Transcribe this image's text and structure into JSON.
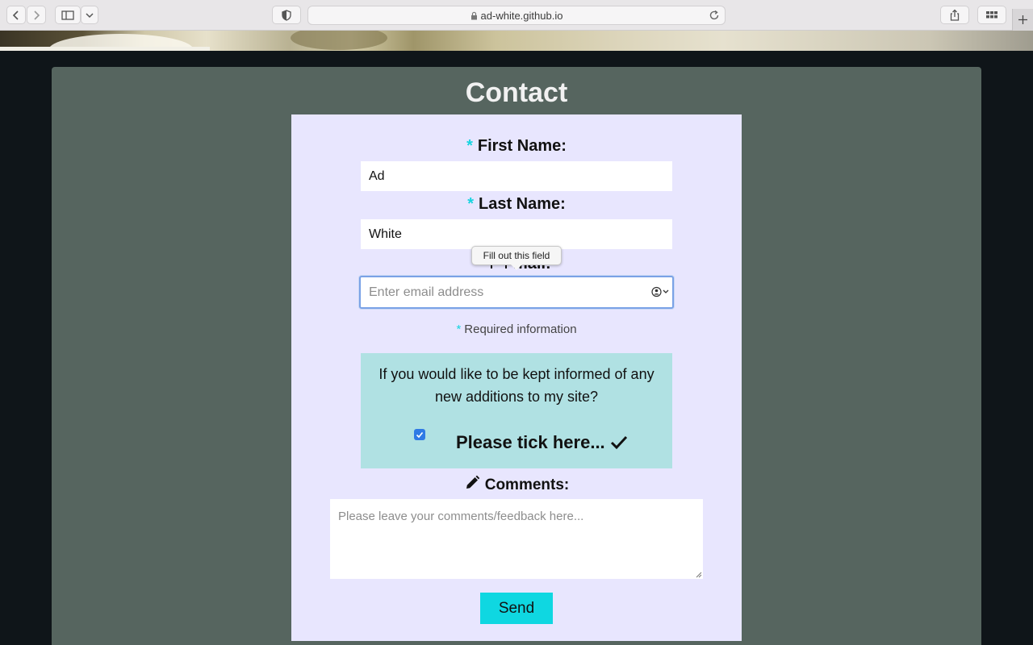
{
  "browser": {
    "url": "ad-white.github.io"
  },
  "page": {
    "title": "Contact"
  },
  "form": {
    "required_marker": "*",
    "first_name": {
      "label": "First Name:",
      "value": "Ad"
    },
    "last_name": {
      "label": "Last Name:",
      "value": "White"
    },
    "email": {
      "placeholder": "Enter email address",
      "validation_tooltip": "Fill out this field",
      "label_peek": "mail:"
    },
    "required_note": "Required information",
    "newsletter": {
      "prompt": "If you would like to be kept informed of any new additions to my site?",
      "checkbox_label": "Please tick here...",
      "checked": true
    },
    "comments": {
      "label": "Comments:",
      "placeholder": "Please leave your comments/feedback here..."
    },
    "submit_label": "Send"
  },
  "colors": {
    "accent": "#0fd7e1",
    "panel": "#56655f",
    "form_bg": "#e8e6fe",
    "newsletter_bg": "#b0e1e3"
  }
}
